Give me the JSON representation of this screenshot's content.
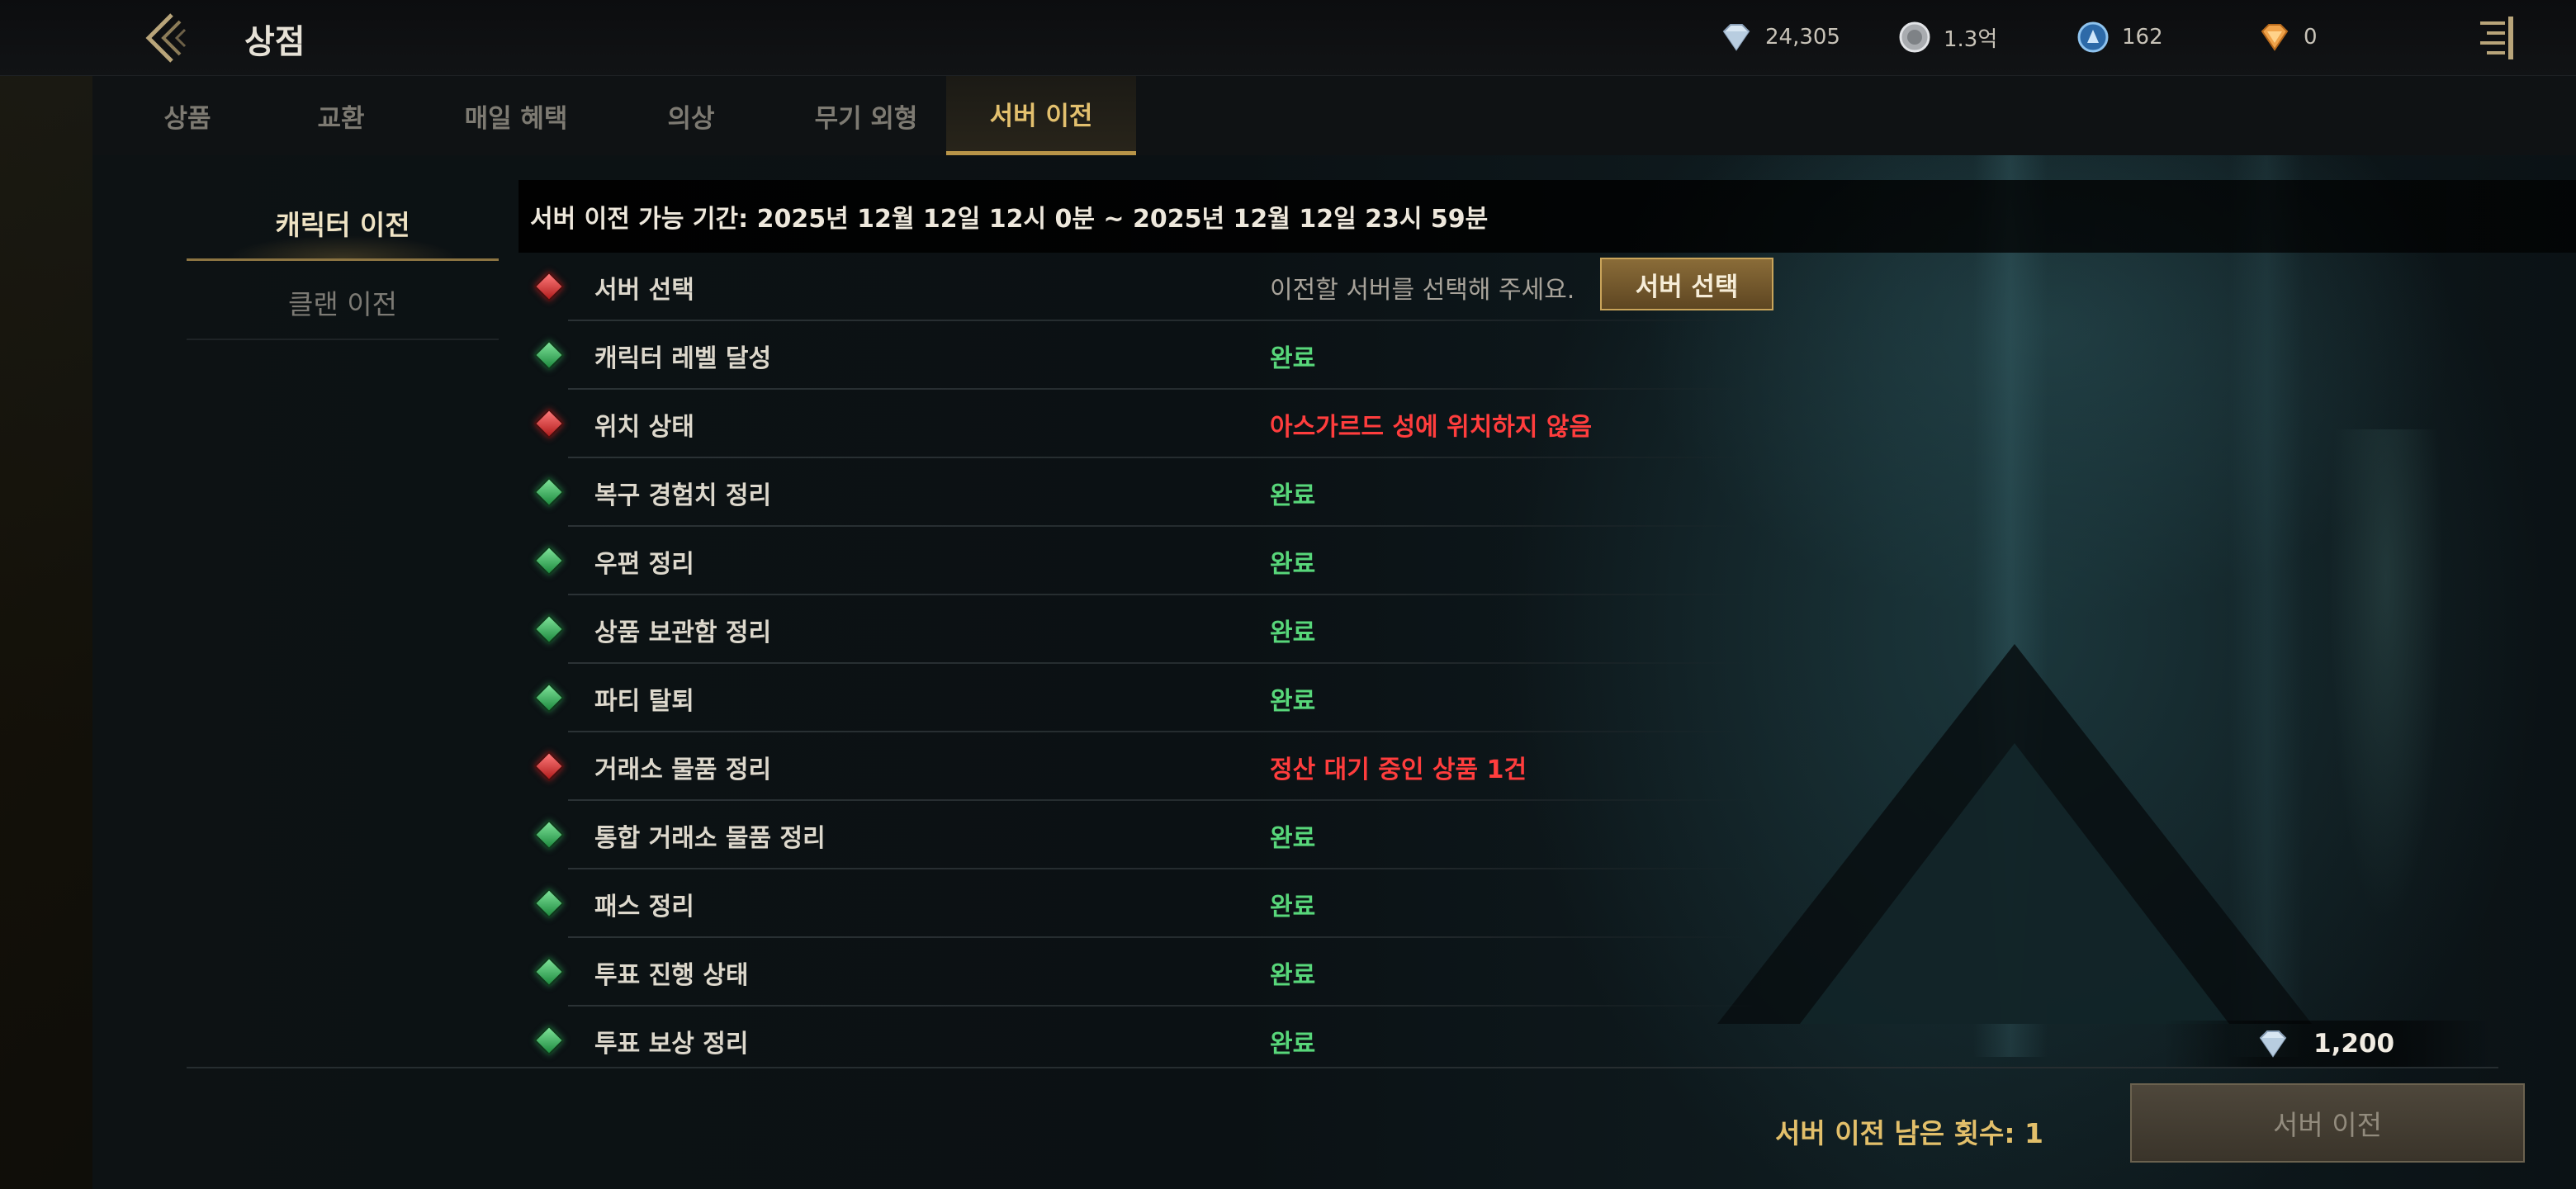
{
  "header": {
    "title": "상점",
    "currencies": [
      {
        "icon": "diamond-icon",
        "value": "24,305"
      },
      {
        "icon": "silver-coin-icon",
        "value": "1.3억"
      },
      {
        "icon": "blue-coin-icon",
        "value": "162"
      },
      {
        "icon": "orange-gem-icon",
        "value": "0"
      }
    ]
  },
  "tabs": [
    {
      "label": "상품"
    },
    {
      "label": "교환"
    },
    {
      "label": "매일 혜택"
    },
    {
      "label": "의상"
    },
    {
      "label": "무기 외형"
    },
    {
      "label": "서버 이전"
    }
  ],
  "left_menu": {
    "active": "캐릭터 이전",
    "inactive": "클랜 이전"
  },
  "period_text": "서버 이전 가능 기간: 2025년 12월 12일 12시 0분 ~ 2025년 12월 12일 23시 59분",
  "rows": [
    {
      "label": "서버 선택",
      "status": "fail",
      "value": "이전할 서버를 선택해 주세요."
    },
    {
      "label": "캐릭터 레벨 달성",
      "status": "ok",
      "value": "완료"
    },
    {
      "label": "위치 상태",
      "status": "fail",
      "value": "아스가르드 성에 위치하지 않음"
    },
    {
      "label": "복구 경험치 정리",
      "status": "ok",
      "value": "완료"
    },
    {
      "label": "우편 정리",
      "status": "ok",
      "value": "완료"
    },
    {
      "label": "상품 보관함 정리",
      "status": "ok",
      "value": "완료"
    },
    {
      "label": "파티 탈퇴",
      "status": "ok",
      "value": "완료"
    },
    {
      "label": "거래소 물품 정리",
      "status": "fail",
      "value": "정산 대기 중인 상품 1건"
    },
    {
      "label": "통합 거래소 물품 정리",
      "status": "ok",
      "value": "완료"
    },
    {
      "label": "패스 정리",
      "status": "ok",
      "value": "완료"
    },
    {
      "label": "투표 진행 상태",
      "status": "ok",
      "value": "완료"
    },
    {
      "label": "투표 보상 정리",
      "status": "ok",
      "value": "완료"
    }
  ],
  "select_server_button": "서버 선택",
  "cost": {
    "icon": "diamond-icon",
    "value": "1,200"
  },
  "remaining_text": "서버 이전 남은 횟수: 1",
  "transfer_button": "서버 이전",
  "colors": {
    "ok": "#58d77a",
    "fail": "#ff3d3d",
    "accent": "#e3c06e"
  }
}
